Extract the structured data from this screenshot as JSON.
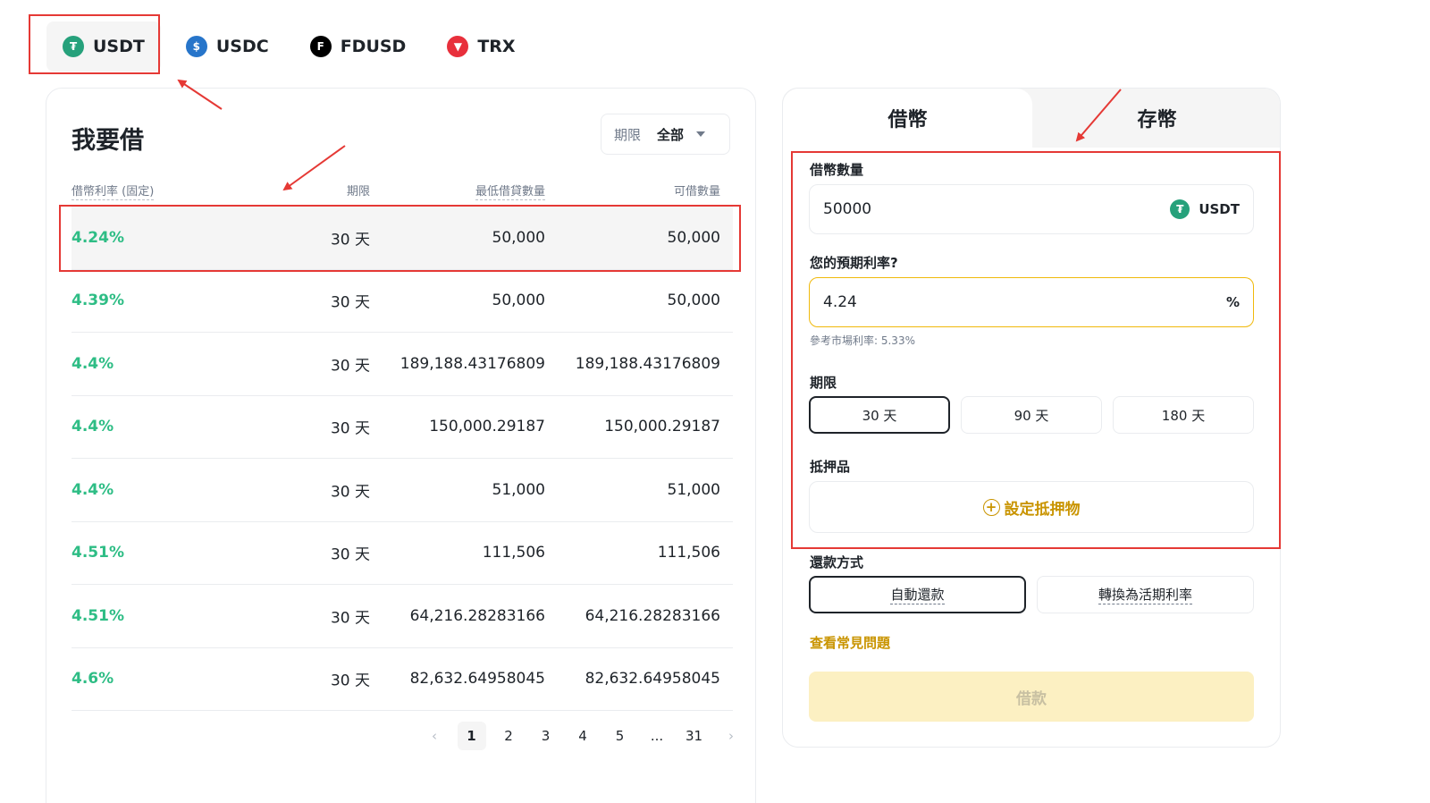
{
  "coin_tabs": [
    {
      "label": "USDT",
      "icon": "tether-icon",
      "active": true
    },
    {
      "label": "USDC",
      "icon": "usdc-icon",
      "active": false
    },
    {
      "label": "FDUSD",
      "icon": "fdusd-icon",
      "active": false
    },
    {
      "label": "TRX",
      "icon": "tron-icon",
      "active": false
    }
  ],
  "left": {
    "title": "我要借",
    "filter": {
      "label": "期限",
      "value": "全部"
    },
    "headers": {
      "rate": "借幣利率 (固定)",
      "term": "期限",
      "min": "最低借貸數量",
      "avail": "可借數量"
    },
    "rows": [
      {
        "rate": "4.24%",
        "term": "30 天",
        "min": "50,000",
        "avail": "50,000"
      },
      {
        "rate": "4.39%",
        "term": "30 天",
        "min": "50,000",
        "avail": "50,000"
      },
      {
        "rate": "4.4%",
        "term": "30 天",
        "min": "189,188.43176809",
        "avail": "189,188.43176809"
      },
      {
        "rate": "4.4%",
        "term": "30 天",
        "min": "150,000.29187",
        "avail": "150,000.29187"
      },
      {
        "rate": "4.4%",
        "term": "30 天",
        "min": "51,000",
        "avail": "51,000"
      },
      {
        "rate": "4.51%",
        "term": "30 天",
        "min": "111,506",
        "avail": "111,506"
      },
      {
        "rate": "4.51%",
        "term": "30 天",
        "min": "64,216.28283166",
        "avail": "64,216.28283166"
      },
      {
        "rate": "4.6%",
        "term": "30 天",
        "min": "82,632.64958045",
        "avail": "82,632.64958045"
      }
    ],
    "pagination": {
      "prev": "‹",
      "pages": [
        "1",
        "2",
        "3",
        "4",
        "5",
        "...",
        "31"
      ],
      "current": "1",
      "next": "›"
    }
  },
  "right": {
    "tabs": {
      "borrow": "借幣",
      "deposit": "存幣"
    },
    "amount": {
      "label": "借幣數量",
      "value": "50000",
      "unit": "USDT"
    },
    "rate": {
      "label": "您的預期利率?",
      "value": "4.24",
      "unit": "%",
      "hint": "參考市場利率: 5.33%"
    },
    "term": {
      "label": "期限",
      "options": [
        "30 天",
        "90 天",
        "180 天"
      ],
      "selected": "30 天"
    },
    "collateral": {
      "label": "抵押品",
      "button": "設定抵押物"
    },
    "repay": {
      "label": "還款方式",
      "options": [
        "自動還款",
        "轉換為活期利率"
      ],
      "selected": "自動還款"
    },
    "faq": "查看常見問題",
    "submit": "借款"
  },
  "colors": {
    "green": "#2ebd85",
    "gold": "#c99400",
    "annotation_red": "#e53935",
    "accent_yellow": "#f0b90b"
  }
}
